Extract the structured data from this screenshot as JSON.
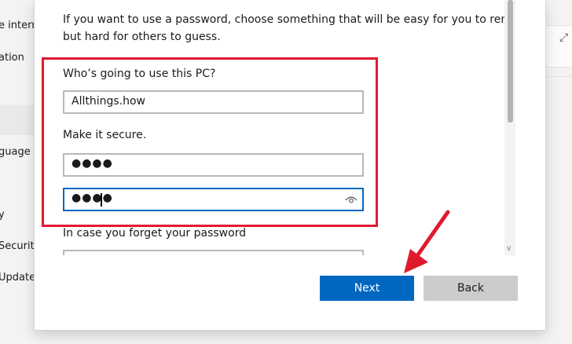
{
  "background": {
    "sidebar_items": [
      "e intern",
      "ation",
      "guage",
      "y",
      "Security",
      "Update"
    ]
  },
  "dialog": {
    "intro_line1": "If you want to use a password, choose something that will be easy for you to remember",
    "intro_line2": "but hard for others to guess.",
    "who_label": "Who’s going to use this PC?",
    "username_value": "Allthings.how",
    "secure_label": "Make it secure.",
    "password_value": "●●●●",
    "confirm_password_value": "●●●●",
    "forget_label": "In case you forget your password",
    "next_label": "Next",
    "back_label": "Back"
  },
  "colors": {
    "accent": "#0067c0",
    "highlight": "#e01a2d"
  },
  "icons": {
    "reveal_password": "eye-icon",
    "annotation": "red-arrow-icon"
  }
}
